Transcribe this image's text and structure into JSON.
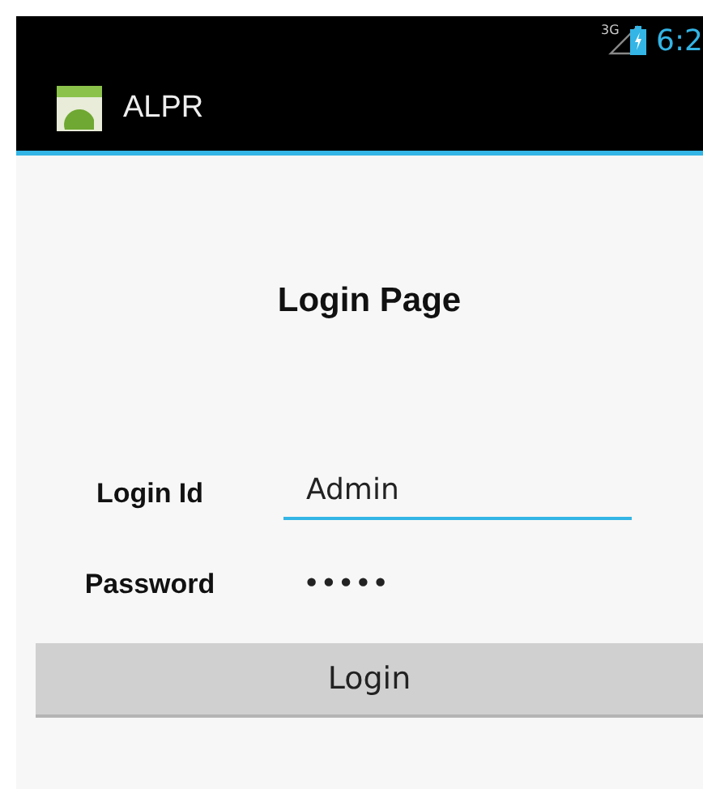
{
  "status_bar": {
    "network": "3G",
    "time": "6:2"
  },
  "action_bar": {
    "title": "ALPR"
  },
  "heading": "Login Page",
  "fields": [
    {
      "label": "Login Id",
      "value": "Admin",
      "focused": true
    },
    {
      "label": "Password",
      "value": "•••••",
      "focused": false
    }
  ],
  "button": "Login"
}
